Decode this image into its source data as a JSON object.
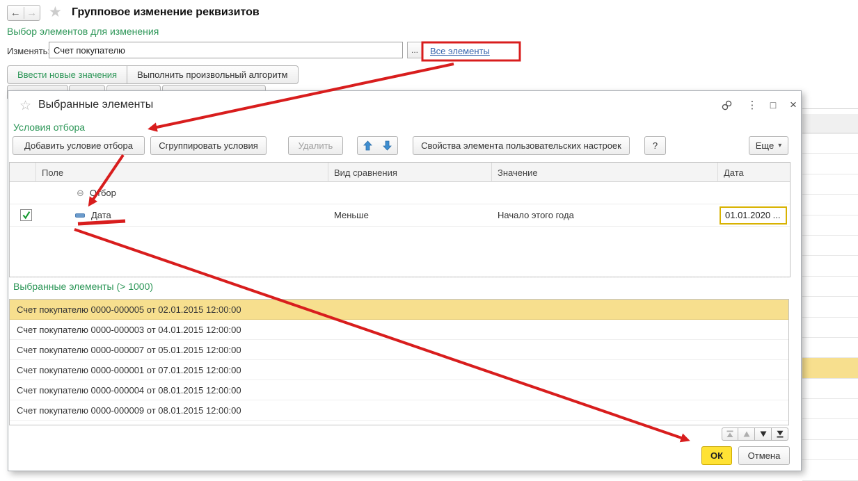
{
  "colors": {
    "green": "#2c9657",
    "link": "#3565ad",
    "red": "#d81d1d",
    "selection": "#f7df8e",
    "ok-bg": "#ffe234",
    "ok-border": "#c9a702",
    "date-border": "#d8b200",
    "arrow-blue": "#3e8ed0"
  },
  "icons": {
    "back": "←",
    "forward": "→",
    "favorite_star": "★",
    "dialog_star": "☆",
    "kebab": "⋮",
    "maximize": "□",
    "close": "×",
    "collapse": "⊖",
    "dropdown": "▾",
    "help": "?",
    "ellipsis": "..."
  },
  "page": {
    "title": "Групповое изменение реквизитов",
    "section_title": "Выбор элементов для изменения",
    "change_label": "Изменять:",
    "change_value": "Счет покупателю",
    "all_elements_link": "Все элементы",
    "tabs": [
      {
        "label": "Ввести новые значения"
      },
      {
        "label": "Выполнить произвольный алгоритм"
      }
    ]
  },
  "dialog": {
    "title": "Выбранные элементы",
    "conditions_title": "Условия отбора",
    "toolbar": {
      "add": "Добавить условие отбора",
      "group": "Сгруппировать условия",
      "delete": "Удалить",
      "properties": "Свойства элемента пользовательских настроек",
      "more": "Еще"
    },
    "table": {
      "columns": [
        "Поле",
        "Вид сравнения",
        "Значение",
        "Дата"
      ],
      "group_row_label": "Отбор",
      "row": {
        "field": "Дата",
        "comparison": "Меньше",
        "value": "Начало этого года",
        "date": "01.01.2020 ..."
      }
    },
    "selected_title": "Выбранные элементы (> 1000)",
    "items": [
      "Счет покупателю 0000-000005 от 02.01.2015 12:00:00",
      "Счет покупателю 0000-000003 от 04.01.2015 12:00:00",
      "Счет покупателю 0000-000007 от 05.01.2015 12:00:00",
      "Счет покупателю 0000-000001 от 07.01.2015 12:00:00",
      "Счет покупателю 0000-000004 от 08.01.2015 12:00:00",
      "Счет покупателю 0000-000009 от 08.01.2015 12:00:00"
    ],
    "ok": "ОК",
    "cancel": "Отмена"
  }
}
